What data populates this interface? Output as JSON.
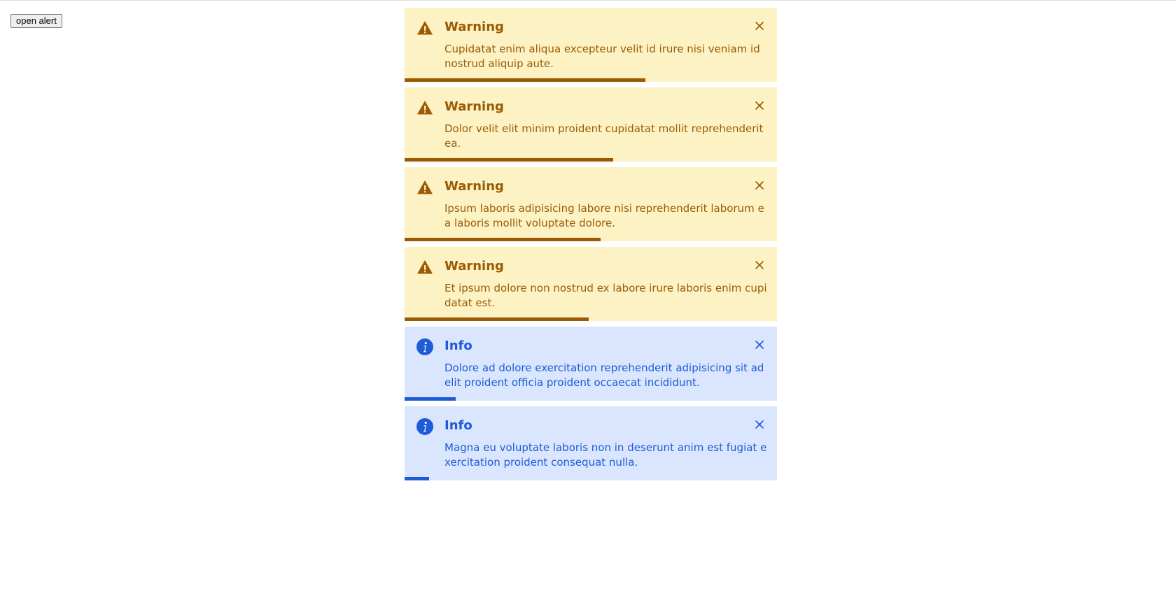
{
  "open_button": {
    "label": "open alert"
  },
  "alerts": [
    {
      "type": "warning",
      "icon": "warning-triangle-icon",
      "title": "Warning",
      "message": "Cupidatat enim aliqua excepteur velit id irure nisi veniam id nostrud aliquip aute.",
      "progress": 0.646
    },
    {
      "type": "warning",
      "icon": "warning-triangle-icon",
      "title": "Warning",
      "message": "Dolor velit elit minim proident cupidatat mollit reprehenderit ea.",
      "progress": 0.56
    },
    {
      "type": "warning",
      "icon": "warning-triangle-icon",
      "title": "Warning",
      "message": "Ipsum laboris adipisicing labore nisi reprehenderit laborum ea laboris mollit voluptate dolore.",
      "progress": 0.526
    },
    {
      "type": "warning",
      "icon": "warning-triangle-icon",
      "title": "Warning",
      "message": "Et ipsum dolore non nostrud ex labore irure laboris enim cupidatat est.",
      "progress": 0.494
    },
    {
      "type": "info",
      "icon": "info-circle-icon",
      "title": "Info",
      "message": "Dolore ad dolore exercitation reprehenderit adipisicing sit ad elit proident officia proident occaecat incididunt.",
      "progress": 0.137
    },
    {
      "type": "info",
      "icon": "info-circle-icon",
      "title": "Info",
      "message": "Magna eu voluptate laboris non in deserunt anim est fugiat exercitation proident consequat nulla.",
      "progress": 0.065
    }
  ],
  "colors": {
    "warning_bg": "#fdf2c4",
    "warning_fg": "#9a5b04",
    "info_bg": "#d9e6fd",
    "info_fg": "#1f5bd8"
  }
}
